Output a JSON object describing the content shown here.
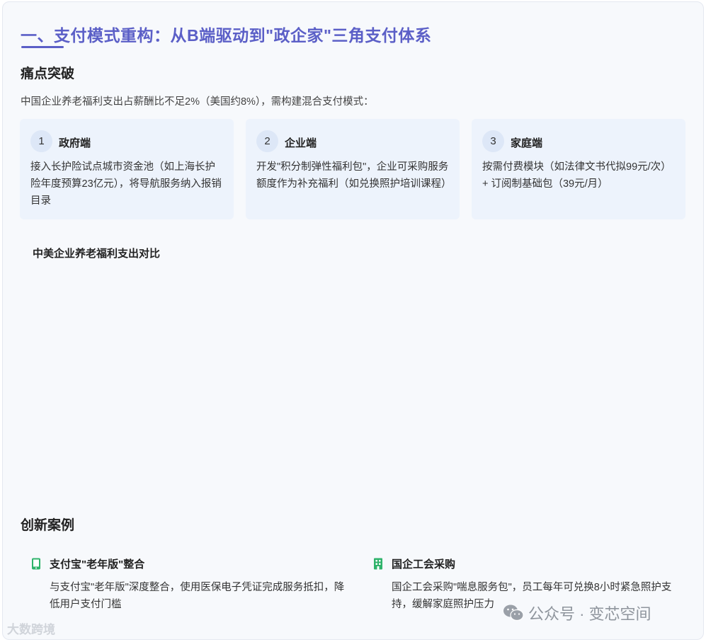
{
  "header": {
    "title": "一、支付模式重构：从B端驱动到\"政企家\"三角支付体系"
  },
  "pain_point": {
    "heading": "痛点突破",
    "intro": "中国企业养老福利支出占薪酬比不足2%（美国约8%），需构建混合支付模式："
  },
  "columns": [
    {
      "number": "1",
      "title": "政府端",
      "body": "接入长护险试点城市资金池（如上海长护险年度预算23亿元），将导航服务纳入报销目录"
    },
    {
      "number": "2",
      "title": "企业端",
      "body": "开发\"积分制弹性福利包\"，企业可采购服务额度作为补充福利（如兑换照护培训课程）"
    },
    {
      "number": "3",
      "title": "家庭端",
      "body": "按需付费模块（如法律文书代拟99元/次）+ 订阅制基础包（39元/月）"
    }
  ],
  "chart": {
    "title": "中美企业养老福利支出对比"
  },
  "cases": {
    "heading": "创新案例",
    "items": [
      {
        "icon": "mobile-phone-icon",
        "icon_color": "#2fb36b",
        "title": "支付宝\"老年版\"整合",
        "body": "与支付宝\"老年版\"深度整合，使用医保电子凭证完成服务抵扣，降低用户支付门槛"
      },
      {
        "icon": "building-icon",
        "icon_color": "#2fb36b",
        "title": "国企工会采购",
        "body": "国企工会采购\"喘息服务包\"，员工每年可兑换8小时紧急照护支持，缓解家庭照护压力"
      }
    ]
  },
  "watermarks": {
    "left": "大数跨境",
    "right": "公众号 · 变芯空间"
  },
  "colors": {
    "accent": "#5b5fc7",
    "card_bg": "#edf3fc",
    "icon_green": "#2fb36b"
  }
}
